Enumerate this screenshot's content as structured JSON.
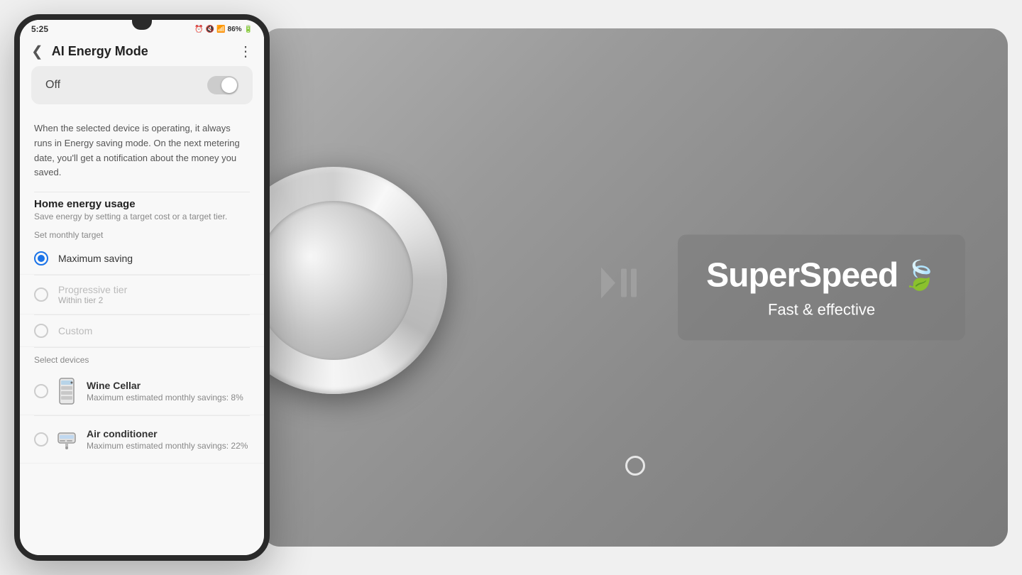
{
  "scene": {
    "background_color": "#e0e0e0"
  },
  "phone": {
    "status_bar": {
      "time": "5:25",
      "icons": "⏰ 🔕 📶 86%"
    },
    "header": {
      "back_icon": "❮",
      "title": "AI Energy Mode",
      "more_icon": "⋮"
    },
    "toggle": {
      "label": "Off",
      "state": "off"
    },
    "description": "When the selected device is operating, it always runs in Energy saving mode. On the next metering date, you'll get a notification about the money you saved.",
    "home_energy": {
      "title": "Home energy usage",
      "subtitle": "Save energy by setting a target cost or a target tier."
    },
    "monthly_target_label": "Set monthly target",
    "radio_options": [
      {
        "id": "maximum-saving",
        "label": "Maximum saving",
        "sublabel": "",
        "selected": true,
        "disabled": false
      },
      {
        "id": "progressive-tier",
        "label": "Progressive tier",
        "sublabel": "Within tier 2",
        "selected": false,
        "disabled": true
      },
      {
        "id": "custom",
        "label": "Custom",
        "sublabel": "",
        "selected": false,
        "disabled": true
      }
    ],
    "select_devices_label": "Select devices",
    "devices": [
      {
        "id": "wine-cellar",
        "name": "Wine Cellar",
        "savings": "Maximum estimated monthly savings: 8%"
      },
      {
        "id": "air-conditioner",
        "name": "Air conditioner",
        "savings": "Maximum estimated monthly savings: 22%"
      }
    ]
  },
  "right_panel": {
    "superspeed_title": "SuperSpeed",
    "leaf_icon": "🍃",
    "subtitle": "Fast & effective"
  },
  "icons": {
    "play_pause": "▷❙❙"
  }
}
